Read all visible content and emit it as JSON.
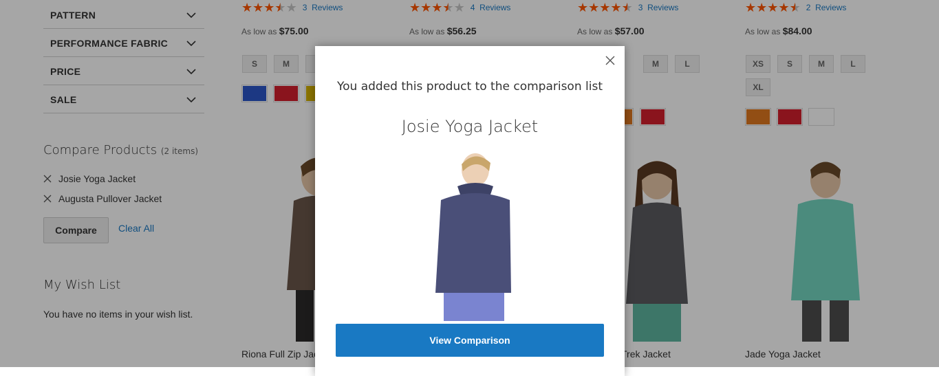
{
  "filters": [
    {
      "label": "PATTERN"
    },
    {
      "label": "PERFORMANCE FABRIC"
    },
    {
      "label": "PRICE"
    },
    {
      "label": "SALE"
    }
  ],
  "compare": {
    "title": "Compare Products",
    "count": "(2 items)",
    "items": [
      "Josie Yoga Jacket",
      "Augusta Pullover Jacket"
    ],
    "compare_label": "Compare",
    "clear_label": "Clear All"
  },
  "wishlist": {
    "title": "My Wish List",
    "empty_text": "You have no items in your wish list."
  },
  "products": [
    {
      "reviews_count": "3",
      "reviews_label": "Reviews",
      "rating": 3.5,
      "as_low_as": "As low as",
      "price": "$75.00",
      "sizes": [
        "S",
        "M",
        ""
      ],
      "colors": [
        "#2c57c9",
        "#d4202d",
        "#d4b100"
      ],
      "name": "Riona Full Zip Jac"
    },
    {
      "reviews_count": "4",
      "reviews_label": "Reviews",
      "rating": 3.5,
      "as_low_as": "As low as",
      "price": "$56.25"
    },
    {
      "reviews_count": "3",
      "reviews_label": "Reviews",
      "rating": 4.5,
      "as_low_as": "As low as",
      "price": "$57.00",
      "sizes": [
        "M",
        "L"
      ],
      "colors": [
        "#e0781f",
        "#d4202d"
      ],
      "name": "Trek Jacket"
    },
    {
      "reviews_count": "2",
      "reviews_label": "Reviews",
      "rating": 4.5,
      "as_low_as": "As low as",
      "price": "$84.00",
      "sizes": [
        "XS",
        "S",
        "M",
        "L",
        "XL"
      ],
      "colors": [
        "#e0781f",
        "#d4202d",
        "#ffffff"
      ],
      "name": "Jade Yoga Jacket"
    }
  ],
  "modal": {
    "message": "You added this product to the comparison list",
    "product_name": "Josie Yoga Jacket",
    "button_label": "View Comparison"
  },
  "colors": {
    "accent": "#1979c3",
    "star": "#ff5501"
  }
}
